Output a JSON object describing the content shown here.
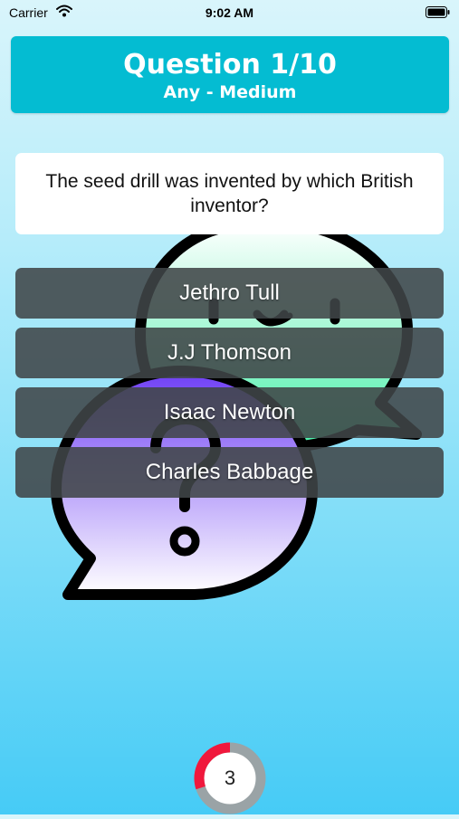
{
  "status_bar": {
    "carrier": "Carrier",
    "time": "9:02 AM"
  },
  "header": {
    "title": "Question 1/10",
    "subtitle": "Any - Medium"
  },
  "question": {
    "text": "The seed drill was invented by which British inventor?"
  },
  "answers": [
    {
      "label": "Jethro Tull"
    },
    {
      "label": "J.J Thomson"
    },
    {
      "label": "Isaac Newton"
    },
    {
      "label": "Charles Babbage"
    }
  ],
  "timer": {
    "value": "3",
    "progress_fraction": 0.3
  },
  "colors": {
    "header_bg": "#04bcd2",
    "answer_bg": "#404648",
    "timer_progress": "#f0183c",
    "timer_track": "#9aa3a6",
    "speech_green": "#46f0a8",
    "speech_purple": "#6f3ff5"
  },
  "icons": [
    "wifi-icon",
    "battery-icon",
    "speech-bubbles-illustration",
    "smiley-face",
    "question-mark"
  ]
}
